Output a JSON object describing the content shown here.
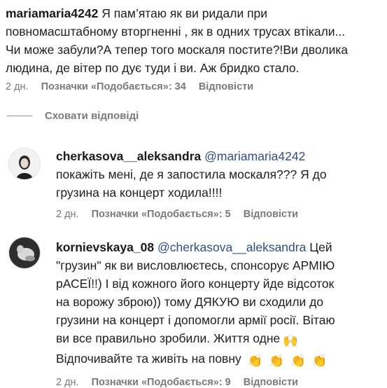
{
  "comment_main": {
    "username": "mariamaria4242",
    "lines": [
      "Я пам’ятаю як ви ридали при",
      "повномасштабному вторгненні , як в одних трусах втікали...",
      "Чи може забули?А тепер того москаля постите?!Ви дволика",
      "людина, де вітер по дує туди і ви. Аж бридко стало."
    ],
    "time": "2 дн.",
    "likes": "Позначки «Подобається»: 34",
    "reply": "Відповісти"
  },
  "hide_replies": "Сховати відповіді",
  "reply1": {
    "username": "cherkasova__aleksandra",
    "mention": "@mariamaria4242",
    "lines": [
      "покажіть мені, де я запостила москаля??? Я до",
      "грузина на концерт ходила!!!!"
    ],
    "time": "2 дн.",
    "likes": "Позначки «Подобається»: 5",
    "reply": "Відповісти"
  },
  "reply2": {
    "username": "kornievskaya_08",
    "mention": "@cherkasova__aleksandra",
    "first_tail": "Цей",
    "lines": [
      "\"грузин\" як ви висловлюєтесь, спонсорує АРМІЮ",
      "рАСЕЇ!!) І від кожного його концерту йде відсоток",
      "на ворожу зброю)) тому ДЯКУЮ ви сходили до",
      "грузини на концерт і допомогли армії росії. Вітаю",
      "ви все правильно зробили. Життя одне",
      "Відпочивайте та живіть на повну"
    ],
    "time": "2 дн.",
    "likes": "Позначки «Подобається»: 9",
    "reply": "Відповісти",
    "emoji_end_line5": "🙌",
    "emoji_clap": "👏"
  }
}
